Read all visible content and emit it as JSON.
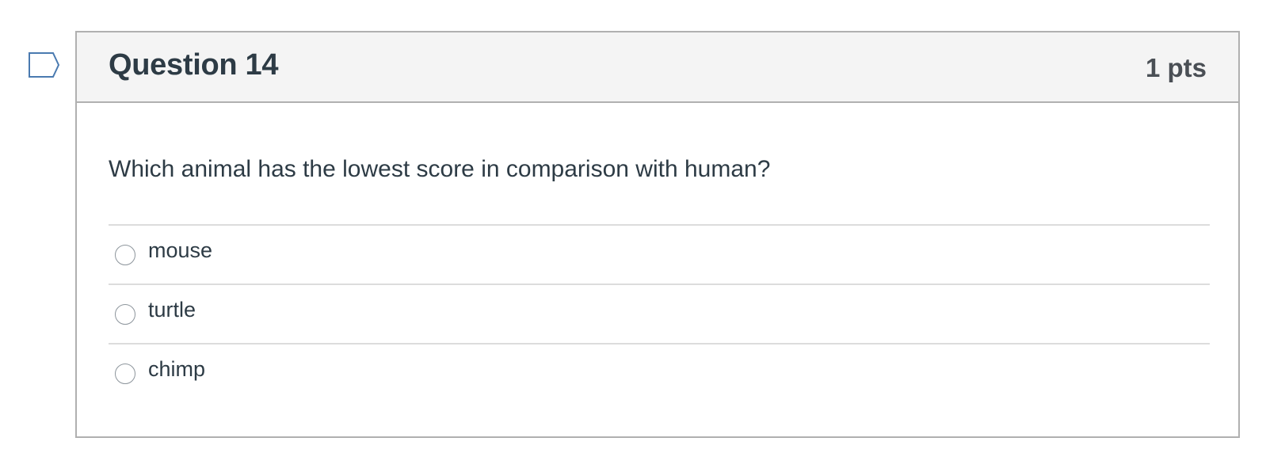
{
  "flag": {
    "icon": "bookmark-flag-icon",
    "color": "#4a7ab0"
  },
  "question": {
    "title": "Question 14",
    "points": "1 pts",
    "text": "Which animal has the lowest score in comparison with human?",
    "answers": [
      {
        "label": "mouse",
        "selected": false
      },
      {
        "label": "turtle",
        "selected": false
      },
      {
        "label": "chimp",
        "selected": false
      }
    ]
  }
}
